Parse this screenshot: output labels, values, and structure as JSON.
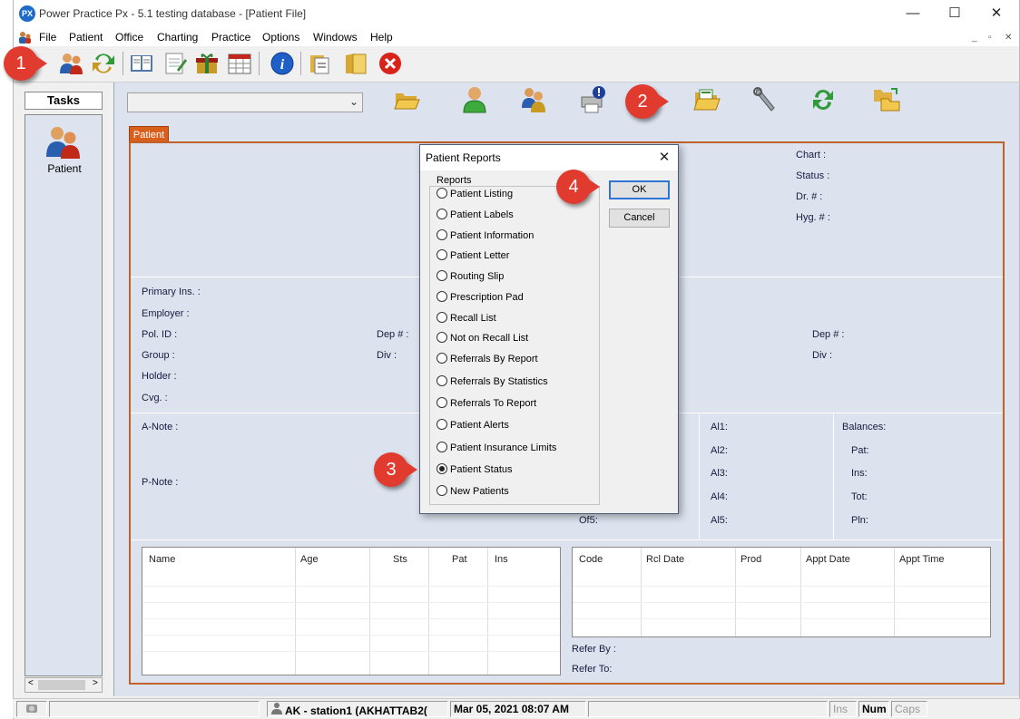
{
  "window": {
    "title": "Power Practice Px - 5.1 testing database - [Patient File]",
    "logo_text": "PX",
    "minimize": "—",
    "maximize": "☐",
    "close": "✕"
  },
  "menu": {
    "items": [
      "File",
      "Patient",
      "Office",
      "Charting",
      "Practice",
      "Options",
      "Windows",
      "Help"
    ],
    "mdi_controls": [
      "_",
      "▫",
      "✕"
    ]
  },
  "toolbar": {
    "icons": [
      "patients-icon",
      "transfer-icon",
      "book-icon",
      "notepad-icon",
      "gift-icon",
      "calendar-icon",
      "info-icon",
      "document-icon",
      "folder-icon",
      "stop-icon"
    ]
  },
  "annotations": [
    {
      "number": "1"
    },
    {
      "number": "2"
    },
    {
      "number": "3"
    },
    {
      "number": "4"
    }
  ],
  "tasks": {
    "header": "Tasks",
    "items": [
      {
        "label": "Patient",
        "icon": "patient-icon"
      }
    ],
    "scroll_left": "<",
    "scroll_right": ">"
  },
  "content": {
    "combo_value": "",
    "combo_arrow": "⌄",
    "tab_label": "Patient",
    "icons": [
      "open-folder-icon",
      "person-icon",
      "group-icon",
      "printer-alert-icon",
      "calculator-icon",
      "reports-folder-icon",
      "wrench-icon",
      "refresh-icon",
      "folders-icon"
    ]
  },
  "patient_info": {
    "right_labels": [
      "Chart :",
      "Status :",
      "Dr. # :",
      "Hyg. # :"
    ],
    "primary_ins": "Primary Ins. :",
    "employer": "Employer :",
    "pol_id": "Pol. ID :",
    "dep1": "Dep # :",
    "group": "Group :",
    "div1": "Div :",
    "holder": "Holder :",
    "cvg": "Cvg. :",
    "dep2": "Dep # :",
    "div2": "Div :",
    "a_note": "A-Note :",
    "p_note": "P-Note :",
    "of5": "Of5:",
    "alerts": [
      "Al1:",
      "Al2:",
      "Al3:",
      "Al4:",
      "Al5:"
    ],
    "balances_title": "Balances:",
    "balances": [
      "Pat:",
      "Ins:",
      "Tot:",
      "Pln:"
    ],
    "refer_by": "Refer By :",
    "refer_to": "Refer To:"
  },
  "family_grid": {
    "headers": [
      "Name",
      "Age",
      "Sts",
      "Pat",
      "Ins"
    ],
    "rows": []
  },
  "recall_grid": {
    "headers": [
      "Code",
      "Rcl Date",
      "Prod",
      "Appt Date",
      "Appt Time"
    ],
    "rows": []
  },
  "dialog": {
    "title": "Patient Reports",
    "close": "✕",
    "group_label": "Reports",
    "options": [
      "Patient Listing",
      "Patient Labels",
      "Patient Information",
      "Patient Letter",
      "Routing Slip",
      "Prescription Pad",
      "Recall List",
      "Not on Recall List",
      "Referrals By Report",
      "Referrals By Statistics",
      "Referrals To Report",
      "Patient Alerts",
      "Patient Insurance Limits",
      "Patient Status",
      "New Patients"
    ],
    "selected": "Patient Status",
    "ok_label": "OK",
    "cancel_label": "Cancel"
  },
  "status_bar": {
    "user": "AK - station1 (AKHATTAB2(",
    "datetime": "Mar 05, 2021 08:07 AM",
    "ins": "Ins",
    "num": "Num",
    "caps": "Caps"
  }
}
